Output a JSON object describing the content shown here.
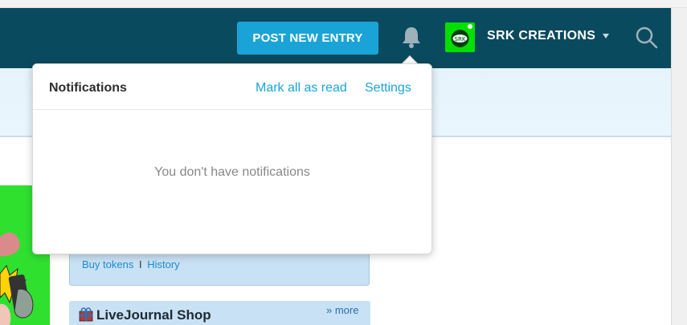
{
  "header": {
    "post_button_label": "POST NEW ENTRY",
    "user_name": "SRK CREATIONS",
    "avatar_text": "SRK",
    "colors": {
      "bar": "#0a4a5e",
      "button": "#1aa3d6",
      "avatar_bg": "#00e000"
    },
    "icons": [
      "bell-icon",
      "chevron-down-icon",
      "search-icon"
    ]
  },
  "notifications": {
    "title": "Notifications",
    "mark_all_label": "Mark all as read",
    "settings_label": "Settings",
    "empty_text": "You don't have notifications"
  },
  "tokens": {
    "buy_label": "Buy tokens",
    "separator": "I",
    "history_label": "History"
  },
  "shop": {
    "title": "LiveJournal Shop",
    "more_label": "» more",
    "icon": "gift-icon"
  }
}
